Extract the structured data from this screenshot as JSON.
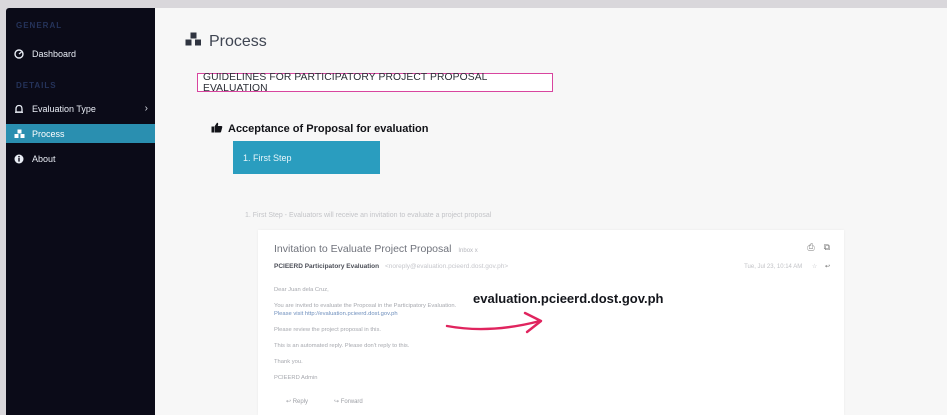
{
  "colors": {
    "sidebar_bg": "#0b0b18",
    "sidebar_active": "#2a8fb0",
    "step_button": "#2a9dbf",
    "guideline_border": "#d8459f",
    "arrow": "#e0245e"
  },
  "sidebar": {
    "section_1": "General",
    "section_2": "Details",
    "items": [
      {
        "label": "Dashboard",
        "icon": "dashboard-icon",
        "active": false
      },
      {
        "label": "Evaluation Type",
        "icon": "bell-icon",
        "active": false,
        "has_submenu": true
      },
      {
        "label": "Process",
        "icon": "cubes-icon",
        "active": true
      },
      {
        "label": "About",
        "icon": "info-icon",
        "active": false
      }
    ]
  },
  "main": {
    "title": "Process",
    "title_icon": "cubes-icon",
    "guideline_title": "GUIDELINES FOR PARTICIPATORY PROJECT PROPOSAL EVALUATION",
    "section_heading": "Acceptance of Proposal for evaluation",
    "section_icon": "thumbs-up-icon",
    "step_button": "1. First Step",
    "step_instruction": "1. First Step - Evaluators will receive an invitation to evaluate a project proposal"
  },
  "email": {
    "subject": "Invitation to Evaluate Project Proposal",
    "subject_tag": "Inbox x",
    "sender": "PCIEERD Participatory Evaluation",
    "sender_address": "<noreply@evaluation.pcieerd.dost.gov.ph>",
    "meta": "Tue, Jul 23, 10:14 AM",
    "body_lines": [
      "Dear Juan dela Cruz,",
      "You are invited to evaluate the Proposal in the Participatory Evaluation.",
      "Please visit http://evaluation.pcieerd.dost.gov.ph",
      "Please review the project proposal in this.",
      "This is an automated reply. Please don't reply to this.",
      "Thank you.",
      "PCIEERD Admin"
    ],
    "reply_label": "Reply",
    "forward_label": "Forward"
  },
  "overlay": {
    "url_text": "evaluation.pcieerd.dost.gov.ph"
  }
}
